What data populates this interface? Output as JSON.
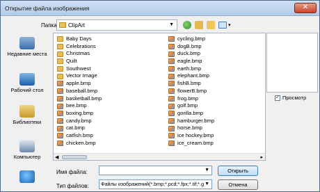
{
  "window": {
    "title": "Открытие файла изображения",
    "close_label": "✕"
  },
  "toolbar": {
    "folder_label": "Папка:",
    "folder_value": "ClipArt"
  },
  "places": [
    {
      "label": "Недавние места",
      "icon": "recent-places-icon"
    },
    {
      "label": "Рабочий стол",
      "icon": "desktop-icon"
    },
    {
      "label": "Библиотеки",
      "icon": "libraries-icon"
    },
    {
      "label": "Компьютер",
      "icon": "computer-icon"
    },
    {
      "label": "",
      "icon": "network-icon"
    }
  ],
  "files": {
    "column1": [
      {
        "name": "Baby Days",
        "type": "folder"
      },
      {
        "name": "Celebrations",
        "type": "folder"
      },
      {
        "name": "Christmas",
        "type": "folder"
      },
      {
        "name": "Quilt",
        "type": "folder"
      },
      {
        "name": "Southwest",
        "type": "folder"
      },
      {
        "name": "Vector Image",
        "type": "folder"
      },
      {
        "name": "apple.bmp",
        "type": "bmp"
      },
      {
        "name": "baseball.bmp",
        "type": "bmp"
      },
      {
        "name": "basketball.bmp",
        "type": "bmp"
      },
      {
        "name": "bee.bmp",
        "type": "bmp"
      },
      {
        "name": "boxing.bmp",
        "type": "bmp"
      },
      {
        "name": "candy.bmp",
        "type": "bmp"
      },
      {
        "name": "cat.bmp",
        "type": "bmp"
      },
      {
        "name": "catfish.bmp",
        "type": "bmp"
      },
      {
        "name": "chicken.bmp",
        "type": "bmp"
      }
    ],
    "column2": [
      {
        "name": "cycling.bmp",
        "type": "bmp"
      },
      {
        "name": "dogB.bmp",
        "type": "bmp"
      },
      {
        "name": "duck.bmp",
        "type": "bmp"
      },
      {
        "name": "eagle.bmp",
        "type": "bmp"
      },
      {
        "name": "earth.bmp",
        "type": "bmp"
      },
      {
        "name": "elephant.bmp",
        "type": "bmp"
      },
      {
        "name": "fishB.bmp",
        "type": "bmp"
      },
      {
        "name": "flowerB.bmp",
        "type": "bmp"
      },
      {
        "name": "frog.bmp",
        "type": "bmp"
      },
      {
        "name": "golf.bmp",
        "type": "bmp"
      },
      {
        "name": "gorilla.bmp",
        "type": "bmp"
      },
      {
        "name": "hamburger.bmp",
        "type": "bmp"
      },
      {
        "name": "horse.bmp",
        "type": "bmp"
      },
      {
        "name": "ice hockey.bmp",
        "type": "bmp"
      },
      {
        "name": "ice_cream.bmp",
        "type": "bmp"
      }
    ]
  },
  "preview": {
    "checkbox_label": "Просмотр",
    "checked": true
  },
  "bottom": {
    "filename_label": "Имя файла:",
    "filename_value": "",
    "filetype_label": "Тип файлов:",
    "filetype_value": "Файлы изображений(*.bmp;*.pcd;*.fpx;*.tif;*.g",
    "open_label": "Открыть",
    "cancel_label": "Отмена"
  }
}
